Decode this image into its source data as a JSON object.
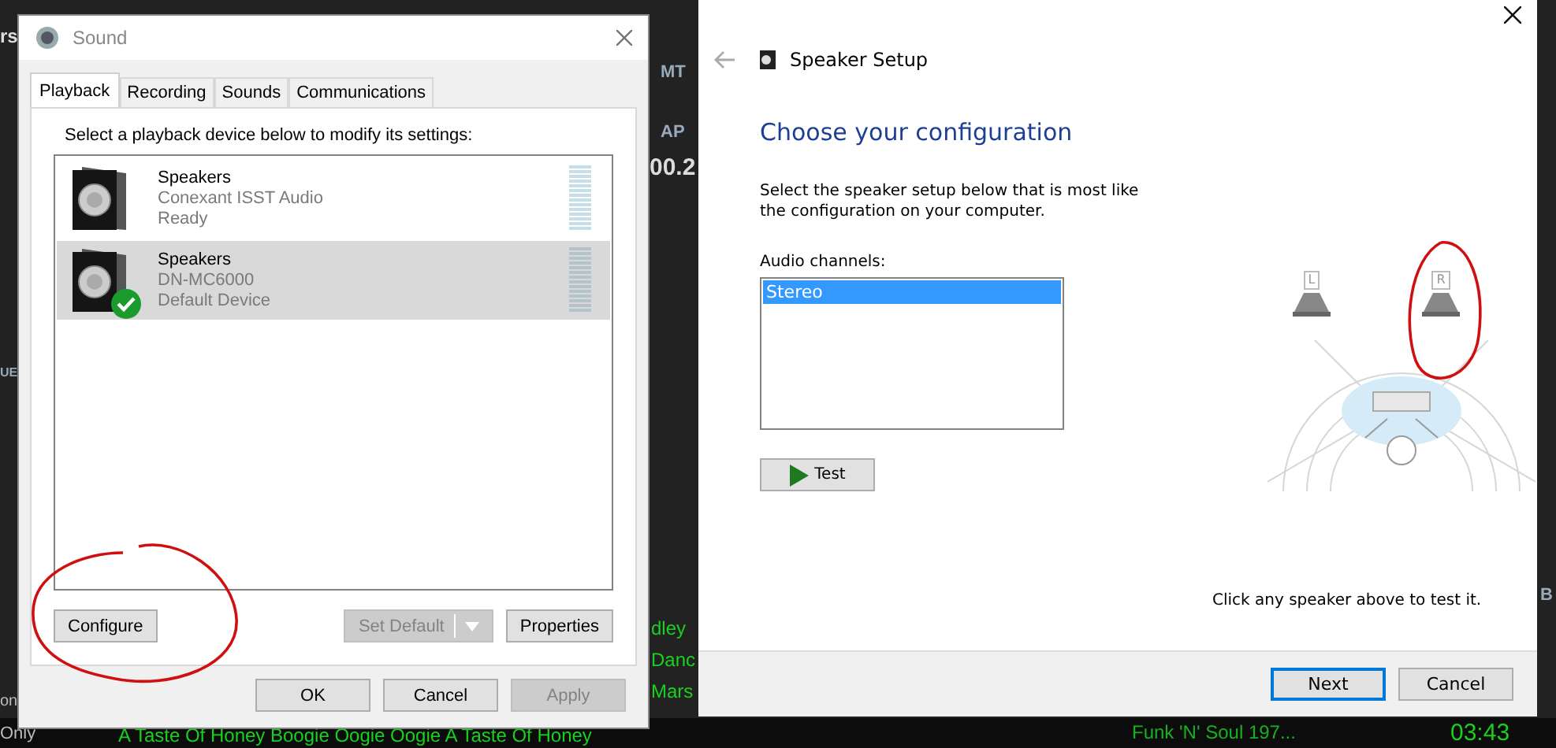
{
  "background_app": {
    "texts": [
      "rs",
      "MT",
      "AP",
      "00.2",
      "UE",
      "dley",
      "Danc",
      "Mars",
      "on",
      "Only",
      "A Taste Of Honey Boogie Oogie Oogie A Taste Of Honey",
      "Funk 'N' Soul 197...",
      "03:43",
      "B"
    ]
  },
  "sound_window": {
    "title": "Sound",
    "tabs": [
      {
        "label": "Playback",
        "selected": true
      },
      {
        "label": "Recording",
        "selected": false
      },
      {
        "label": "Sounds",
        "selected": false
      },
      {
        "label": "Communications",
        "selected": false
      }
    ],
    "instruction": "Select a playback device below to modify its settings:",
    "devices": [
      {
        "name": "Speakers",
        "driver": "Conexant ISST Audio",
        "status": "Ready",
        "selected": false,
        "default": false
      },
      {
        "name": "Speakers",
        "driver": "DN-MC6000",
        "status": "Default Device",
        "selected": true,
        "default": true
      }
    ],
    "actions": [
      {
        "label": "Configure",
        "disabled": false,
        "kind": "plain"
      },
      {
        "label": "Set Default",
        "disabled": true,
        "kind": "split"
      },
      {
        "label": "Properties",
        "disabled": false,
        "kind": "plain"
      }
    ],
    "buttons": [
      {
        "label": "OK",
        "disabled": false
      },
      {
        "label": "Cancel",
        "disabled": false
      },
      {
        "label": "Apply",
        "disabled": true
      }
    ]
  },
  "speaker_setup": {
    "title": "Speaker Setup",
    "heading": "Choose your configuration",
    "description": "Select the speaker setup below that is most like the configuration on your computer.",
    "channels_label": "Audio channels:",
    "channels": [
      {
        "label": "Stereo",
        "selected": true
      }
    ],
    "test_button": "Test",
    "speakers": [
      {
        "label": "L"
      },
      {
        "label": "R"
      }
    ],
    "hint": "Click any speaker above to test it.",
    "buttons": [
      {
        "label": "Next",
        "focused": true
      },
      {
        "label": "Cancel",
        "focused": false
      }
    ]
  }
}
